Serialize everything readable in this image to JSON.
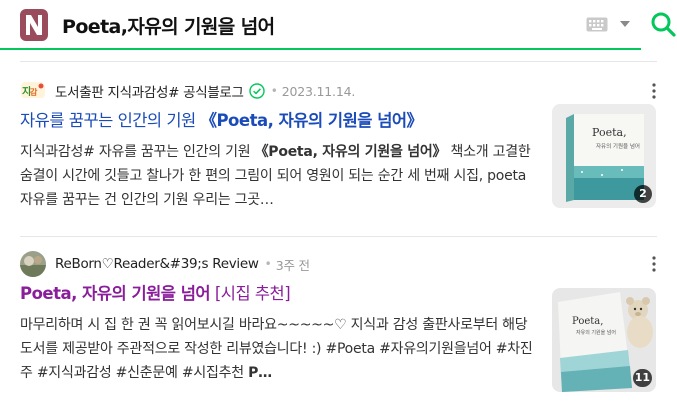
{
  "header": {
    "query": "Poeta,자유의 기원을 넘어",
    "logo_icon": "naver-n-logo",
    "keyboard_icon": "keyboard-icon",
    "dropdown_icon": "caret-down-icon",
    "search_icon": "search-icon",
    "accent_color": "#03c75a"
  },
  "results": [
    {
      "source": "도서출판 지식과감성# 공식블로그",
      "verified": true,
      "date": "2023.11.14.",
      "title_prefix": "자유를 꿈꾸는 인간의 기원 ",
      "title_bold": "《Poeta, 자유의 기원을 넘어》",
      "title_suffix": "",
      "title_color": "#1a4bb8",
      "desc": [
        {
          "text": "지식과감성# 자유를 꿈꾸는 인간의 기원 ",
          "bold": false
        },
        {
          "text": "《Poeta, 자유의 기원을 넘어》",
          "bold": true
        },
        {
          "text": " 책소개 고결한 숨결이 시간에 깃들고 찰나가 한 편의 그림이 되어 영원이 되는 순간 세 번째 시집, poeta 자유를 꿈꾸는 건 인간의 기원 우리는 그곳…",
          "bold": false
        }
      ],
      "image_count": "2",
      "thumb_alt": "Poeta, 자유의 기원을 넘어 book cover"
    },
    {
      "source": "ReBorn♡Reader&#39;s Review",
      "verified": false,
      "date": "3주 전",
      "title_prefix": "",
      "title_bold": "Poeta, 자유의 기원을 넘어",
      "title_suffix": " [시집 추천]",
      "title_color": "#8a1d9a",
      "desc": [
        {
          "text": "마무리하며 시 집 한 권 꼭 읽어보시길 바라요~~~~~♡ 지식과 감성 출판사로부터 해당 도서를 제공받아 주관적으로 작성한 리뷰였습니다! :) #Poeta #자유의기원을넘어 #차진주 #지식과감성 #신춘문예 #시집추천 ",
          "bold": false
        },
        {
          "text": "P…",
          "bold": true
        }
      ],
      "image_count": "11",
      "thumb_alt": "Poeta book with teddy bear"
    }
  ],
  "icons": {
    "verified": "verified-check-icon",
    "more": "more-vertical-icon"
  }
}
